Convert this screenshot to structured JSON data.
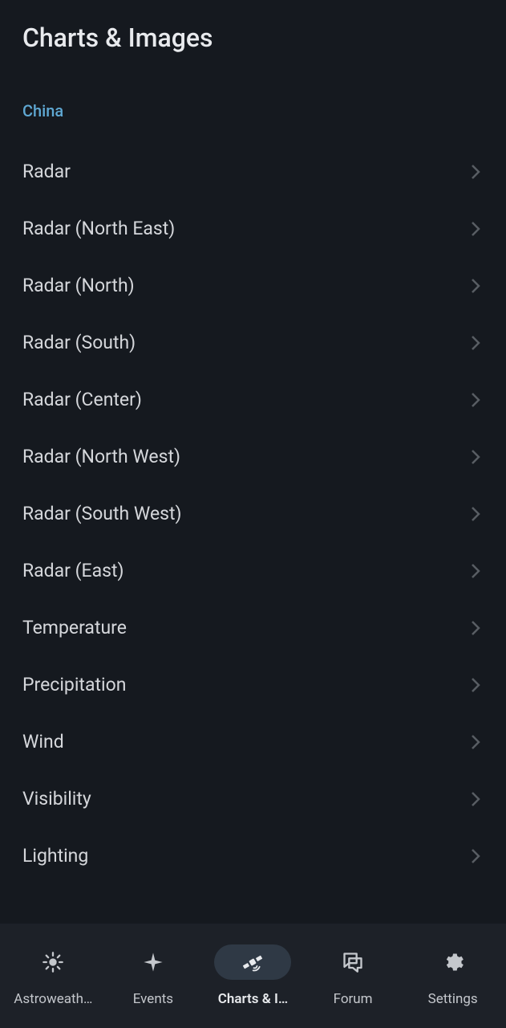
{
  "page": {
    "title": "Charts & Images"
  },
  "section": {
    "header": "China",
    "items": [
      {
        "label": "Radar"
      },
      {
        "label": "Radar (North East)"
      },
      {
        "label": "Radar (North)"
      },
      {
        "label": "Radar (South)"
      },
      {
        "label": "Radar (Center)"
      },
      {
        "label": "Radar (North West)"
      },
      {
        "label": "Radar (South West)"
      },
      {
        "label": "Radar (East)"
      },
      {
        "label": "Temperature"
      },
      {
        "label": "Precipitation"
      },
      {
        "label": "Wind"
      },
      {
        "label": "Visibility"
      },
      {
        "label": "Lighting"
      }
    ]
  },
  "nav": {
    "items": [
      {
        "label": "Astroweath…",
        "icon": "sun",
        "active": false
      },
      {
        "label": "Events",
        "icon": "sparkle",
        "active": false
      },
      {
        "label": "Charts & I…",
        "icon": "satellite",
        "active": true
      },
      {
        "label": "Forum",
        "icon": "chat",
        "active": false
      },
      {
        "label": "Settings",
        "icon": "gear",
        "active": false
      }
    ]
  }
}
